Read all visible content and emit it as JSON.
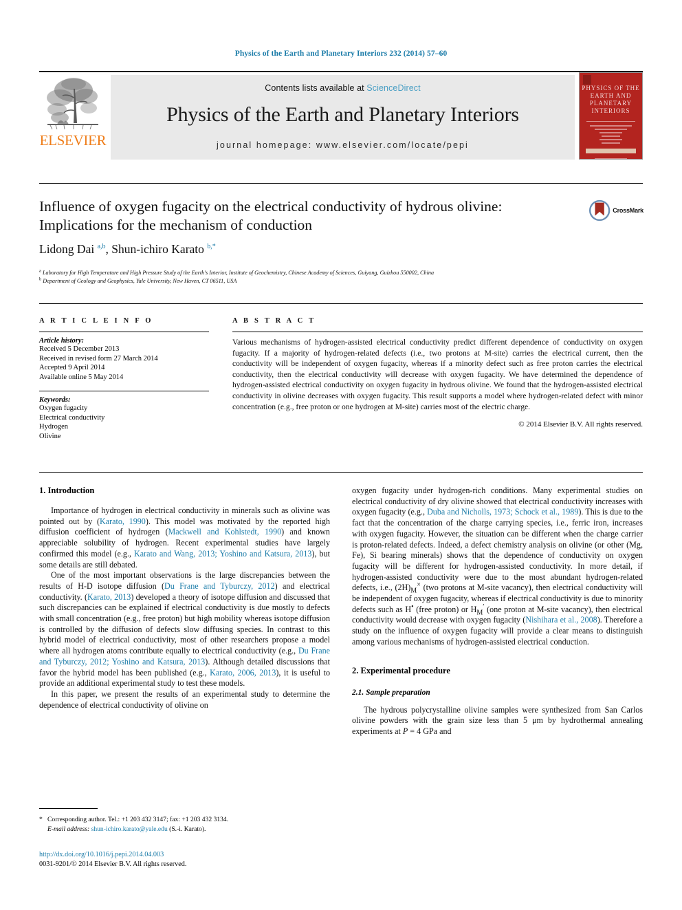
{
  "running_head": "Physics of the Earth and Planetary Interiors 232 (2014) 57–60",
  "masthead": {
    "contents_prefix": "Contents lists available at ",
    "sciencedirect": "ScienceDirect",
    "journal_title": "Physics of the Earth and Planetary Interiors",
    "homepage": "journal homepage: www.elsevier.com/locate/pepi",
    "publisher_wordmark": "ELSEVIER",
    "cover_title": "PHYSICS OF THE EARTH AND PLANETARY INTERIORS"
  },
  "colors": {
    "link": "#1a7ba8",
    "sciencedirect": "#4a9fc4",
    "elsevier_orange": "#ef7d19",
    "cover_red": "#b3241f",
    "masthead_gray": "#e9e9e9"
  },
  "article": {
    "title": "Influence of oxygen fugacity on the electrical conductivity of hydrous olivine: Implications for the mechanism of conduction",
    "crossmark_label": "CrossMark",
    "authors": "Lidong Dai a,b, Shun-ichiro Karato b,*",
    "affiliation_a": "Laboratory for High Temperature and High Pressure Study of the Earth's Interior, Institute of Geochemistry, Chinese Academy of Sciences, Guiyang, Guizhou 550002, China",
    "affiliation_b": "Department of Geology and Geophysics, Yale University, New Haven, CT 06511, USA"
  },
  "article_info": {
    "heading": "A R T I C L E  I N F O",
    "history_label": "Article history:",
    "history": [
      "Received 5 December 2013",
      "Received in revised form 27 March 2014",
      "Accepted 9 April 2014",
      "Available online 5 May 2014"
    ],
    "keywords_label": "Keywords:",
    "keywords": [
      "Oxygen fugacity",
      "Electrical conductivity",
      "Hydrogen",
      "Olivine"
    ]
  },
  "abstract": {
    "heading": "A B S T R A C T",
    "text": "Various mechanisms of hydrogen-assisted electrical conductivity predict different dependence of conductivity on oxygen fugacity. If a majority of hydrogen-related defects (i.e., two protons at M-site) carries the electrical current, then the conductivity will be independent of oxygen fugacity, whereas if a minority defect such as free proton carries the electrical conductivity, then the electrical conductivity will decrease with oxygen fugacity. We have determined the dependence of hydrogen-assisted electrical conductivity on oxygen fugacity in hydrous olivine. We found that the hydrogen-assisted electrical conductivity in olivine decreases with oxygen fugacity. This result supports a model where hydrogen-related defect with minor concentration (e.g., free proton or one hydrogen at M-site) carries most of the electric charge.",
    "copyright": "© 2014 Elsevier B.V. All rights reserved."
  },
  "sections": {
    "introduction_heading": "1. Introduction",
    "intro_p1_a": "Importance of hydrogen in electrical conductivity in minerals such as olivine was pointed out by (",
    "intro_p1_cite1": "Karato, 1990",
    "intro_p1_b": "). This model was motivated by the reported high diffusion coefficient of hydrogen (",
    "intro_p1_cite2": "Mackwell and Kohlstedt, 1990",
    "intro_p1_c": ") and known appreciable solubility of hydrogen. Recent experimental studies have largely confirmed this model (e.g., ",
    "intro_p1_cite3": "Karato and Wang, 2013; Yoshino and Katsura, 2013",
    "intro_p1_d": "), but some details are still debated.",
    "intro_p2_a": "One of the most important observations is the large discrepancies between the results of H-D isotope diffusion (",
    "intro_p2_cite1": "Du Frane and Tyburczy, 2012",
    "intro_p2_b": ") and electrical conductivity. (",
    "intro_p2_cite2": "Karato, 2013",
    "intro_p2_c": ") developed a theory of isotope diffusion and discussed that such discrepancies can be explained if electrical conductivity is due mostly to defects with small concentration (e.g., free proton) but high mobility whereas isotope diffusion is controlled by the diffusion of defects slow diffusing species. In contrast to this hybrid model of electrical conductivity, most of other researchers propose a model where all hydrogen atoms contribute equally to electrical conductivity (e.g., ",
    "intro_p2_cite3": "Du Frane and Tyburczy, 2012; Yoshino and Katsura, 2013",
    "intro_p2_d": "). Although detailed discussions that favor the hybrid model has been published (e.g., ",
    "intro_p2_cite4": "Karato, 2006, 2013",
    "intro_p2_e": "), it is useful to provide an additional experimental study to test these models.",
    "intro_p3": "In this paper, we present the results of an experimental study to determine the dependence of electrical conductivity of olivine on",
    "right_p1_a": "oxygen fugacity under hydrogen-rich conditions. Many experimental studies on electrical conductivity of dry olivine showed that electrical conductivity increases with oxygen fugacity (e.g., ",
    "right_p1_cite1": "Duba and Nicholls, 1973; Schock et al., 1989",
    "right_p1_b": "). This is due to the fact that the concentration of the charge carrying species, i.e., ferric iron, increases with oxygen fugacity. However, the situation can be different when the charge carrier is proton-related defects. Indeed, a defect chemistry analysis on olivine (or other (Mg, Fe), Si bearing minerals) shows that the dependence of conductivity on oxygen fugacity will be different for hydrogen-assisted conductivity. In more detail, if hydrogen-assisted conductivity were due to the most abundant hydrogen-related defects, i.e., ",
    "right_p1_formula1": "(2H)",
    "right_p1_formula1_sub": "M",
    "right_p1_formula1_sup": "×",
    "right_p1_c": " (two protons at M-site vacancy), then electrical conductivity will be independent of oxygen fugacity, whereas if electrical conductivity is due to minority defects such as H",
    "right_p1_sup_dot": "•",
    "right_p1_d": " (free proton) or ",
    "right_p1_formula2": "H",
    "right_p1_formula2_sub": "M",
    "right_p1_formula2_sup": "′",
    "right_p1_e": " (one proton at M-site vacancy), then electrical conductivity would decrease with oxygen fugacity (",
    "right_p1_cite2": "Nishihara et al., 2008",
    "right_p1_f": "). Therefore a study on the influence of oxygen fugacity will provide a clear means to distinguish among various mechanisms of hydrogen-assisted electrical conduction.",
    "experimental_heading": "2. Experimental procedure",
    "sample_prep_heading": "2.1. Sample preparation",
    "sample_prep_p1_a": "The hydrous polycrystalline olivine samples were synthesized from San Carlos olivine powders with the grain size less than 5 μm by hydrothermal annealing experiments at ",
    "sample_prep_p1_italic": "P",
    "sample_prep_p1_b": " = 4 GPa and"
  },
  "footnotes": {
    "corresponding": "Corresponding author. Tel.: +1 203 432 3147; fax: +1 203 432 3134.",
    "email_label": "E-mail address:",
    "email": "shun-ichiro.karato@yale.edu",
    "email_suffix": " (S.-i. Karato)."
  },
  "doi_block": {
    "doi_url": "http://dx.doi.org/10.1016/j.pepi.2014.04.003",
    "issn_line": "0031-9201/© 2014 Elsevier B.V. All rights reserved."
  }
}
